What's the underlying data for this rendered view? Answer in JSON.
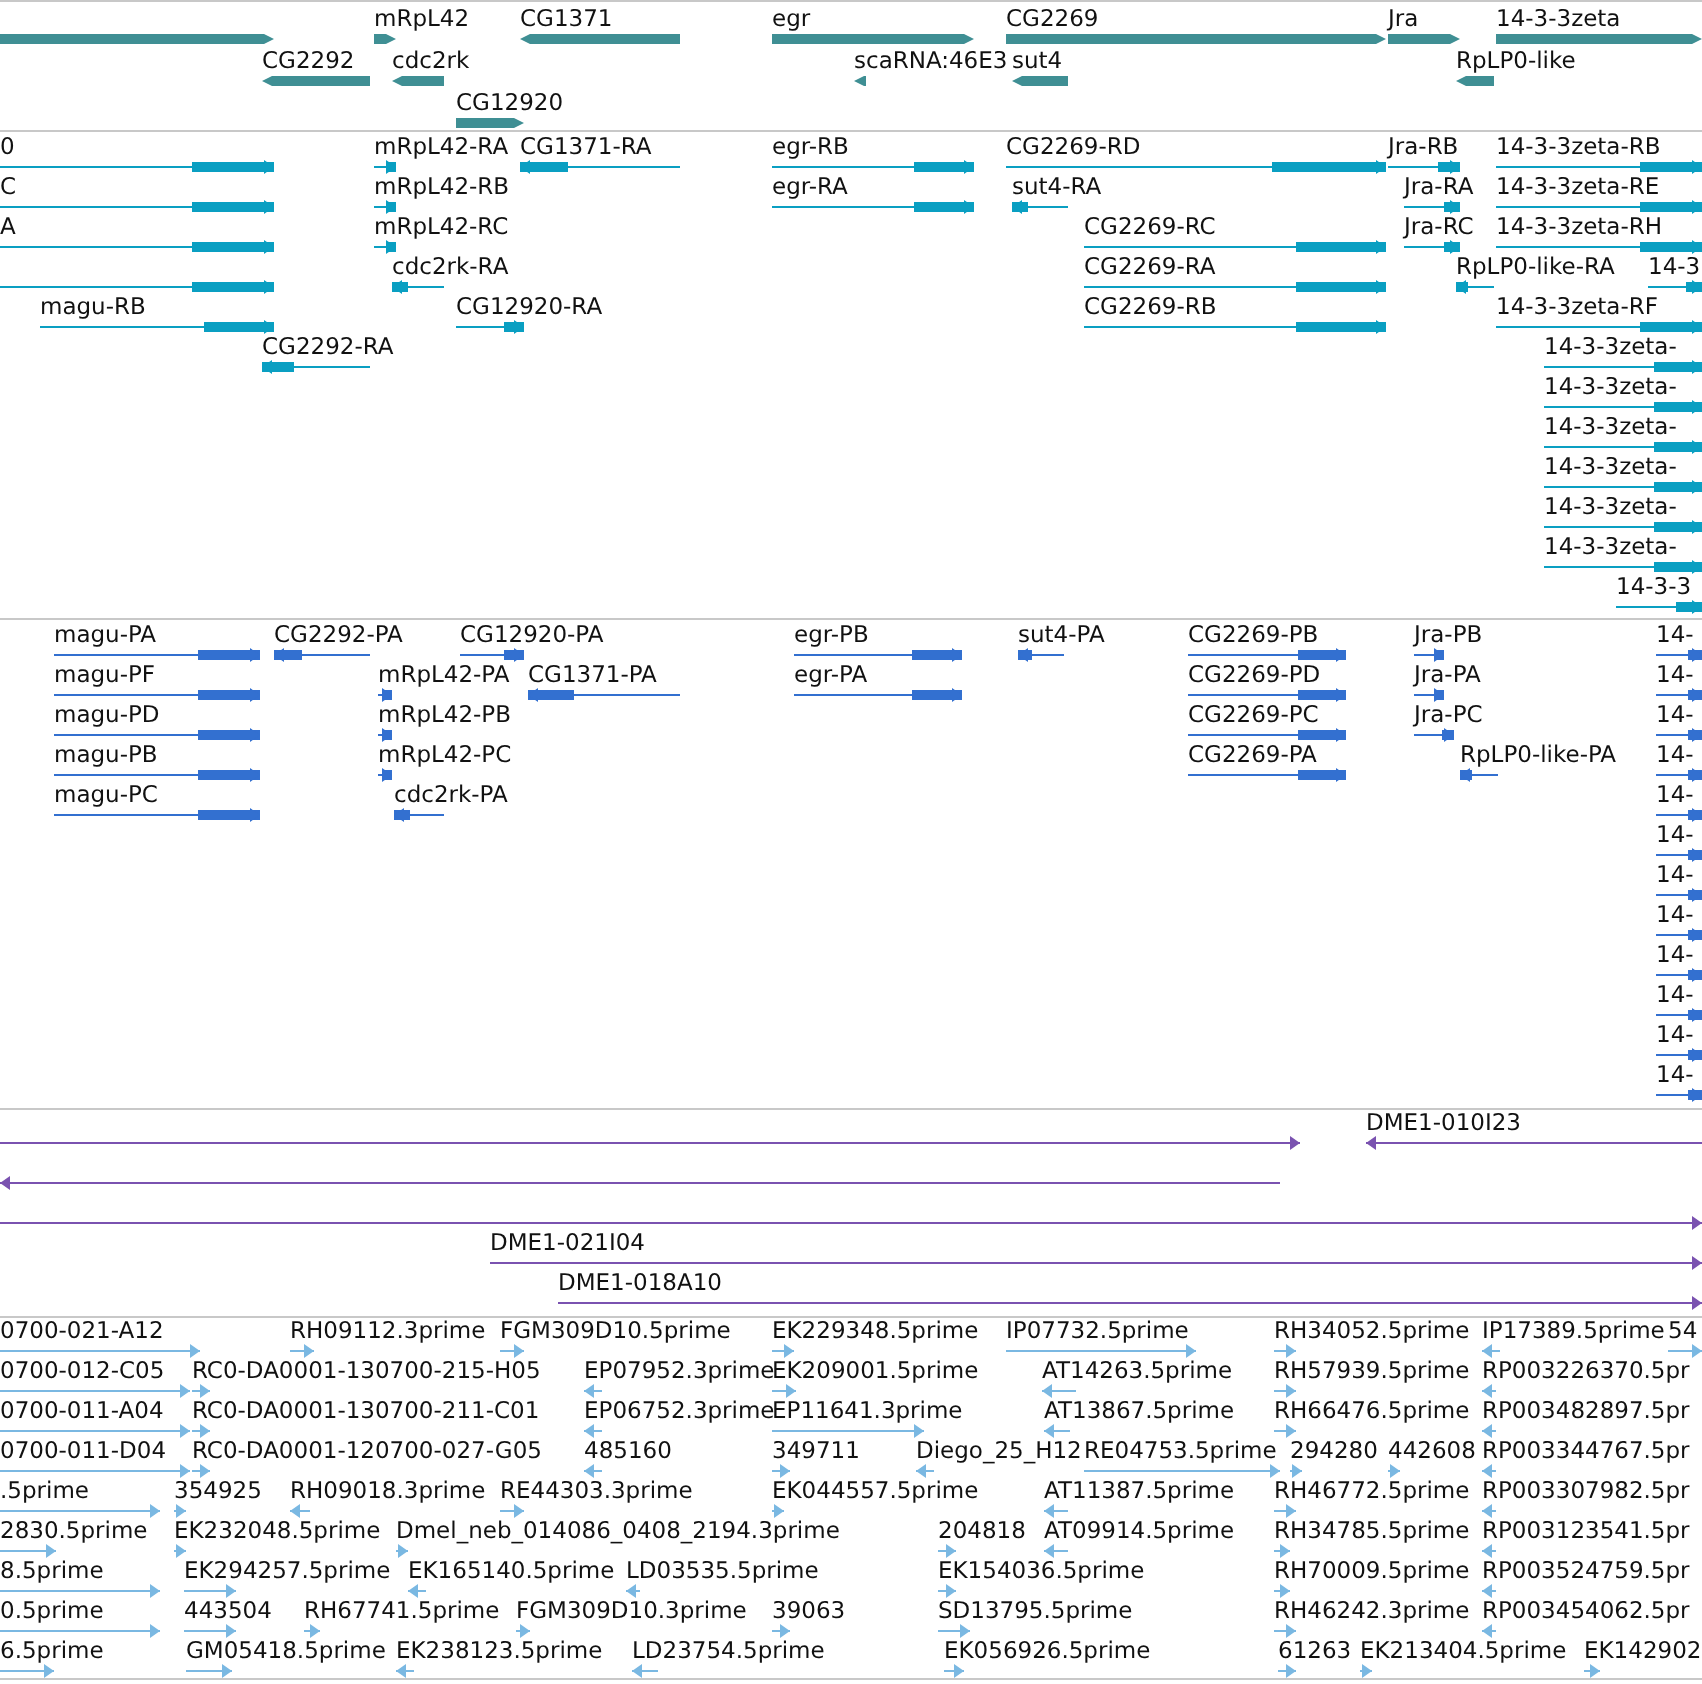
{
  "tracks": [
    {
      "kind": "gene",
      "features": [
        {
          "reverse": false
        },
        {
          "label": "mRpL42",
          "reverse": false
        },
        {
          "label": "CG1371",
          "reverse": true
        },
        {
          "label": "egr",
          "reverse": false
        },
        {
          "label": "CG2269",
          "reverse": false
        },
        {
          "label": "Jra",
          "reverse": false
        },
        {
          "label": "14-3-3zeta",
          "reverse": false
        },
        {
          "label": "CG2292",
          "reverse": true
        },
        {
          "label": "cdc2rk",
          "reverse": true
        },
        {
          "label": "scaRNA:46E3",
          "reverse": true
        },
        {
          "label": "sut4",
          "reverse": true
        },
        {
          "label": "RpLP0-like",
          "reverse": true
        },
        {
          "label": "CG12920",
          "reverse": false
        }
      ]
    },
    {
      "kind": "transcript",
      "features": [
        {
          "label": "0",
          "reverse": false
        },
        {
          "label": "mRpL42-RA",
          "reverse": false
        },
        {
          "label": "CG1371-RA",
          "reverse": true
        },
        {
          "label": "egr-RB",
          "reverse": false
        },
        {
          "label": "CG2269-RD",
          "reverse": false
        },
        {
          "label": "Jra-RB",
          "reverse": false
        },
        {
          "label": "14-3-3zeta-RB",
          "reverse": false
        },
        {
          "label": "C",
          "reverse": false
        },
        {
          "label": "mRpL42-RB",
          "reverse": false
        },
        {
          "label": "egr-RA",
          "reverse": false
        },
        {
          "label": "sut4-RA",
          "reverse": true
        },
        {
          "label": "Jra-RA",
          "reverse": false
        },
        {
          "label": "14-3-3zeta-RE",
          "reverse": false
        },
        {
          "label": "A",
          "reverse": false
        },
        {
          "label": "mRpL42-RC",
          "reverse": false
        },
        {
          "label": "CG2269-RC",
          "reverse": false
        },
        {
          "label": "Jra-RC",
          "reverse": false
        },
        {
          "label": "14-3-3zeta-RH",
          "reverse": false
        },
        {
          "reverse": false
        },
        {
          "label": "cdc2rk-RA",
          "reverse": true
        },
        {
          "label": "CG2269-RA",
          "reverse": false
        },
        {
          "label": "RpLP0-like-RA",
          "reverse": true
        },
        {
          "label": "14-3",
          "reverse": false
        },
        {
          "label": "magu-RB",
          "reverse": false
        },
        {
          "label": "CG12920-RA",
          "reverse": false
        },
        {
          "label": "CG2269-RB",
          "reverse": false
        },
        {
          "label": "14-3-3zeta-RF",
          "reverse": false
        },
        {
          "label": "CG2292-RA",
          "reverse": true
        },
        {
          "label": "14-3-3zeta-",
          "reverse": false
        },
        {
          "label": "14-3-3zeta-",
          "reverse": false
        },
        {
          "label": "14-3-3zeta-",
          "reverse": false
        },
        {
          "label": "14-3-3zeta-",
          "reverse": false
        },
        {
          "label": "14-3-3zeta-",
          "reverse": false
        },
        {
          "label": "14-3-3zeta-",
          "reverse": false
        },
        {
          "label": "14-3-3",
          "reverse": false
        }
      ]
    },
    {
      "kind": "protein",
      "features": [
        {
          "label": "magu-PA",
          "reverse": false
        },
        {
          "label": "CG2292-PA",
          "reverse": true
        },
        {
          "label": "CG12920-PA",
          "reverse": false
        },
        {
          "label": "egr-PB",
          "reverse": false
        },
        {
          "label": "sut4-PA",
          "reverse": true
        },
        {
          "label": "CG2269-PB",
          "reverse": false
        },
        {
          "label": "Jra-PB",
          "reverse": false
        },
        {
          "label": "14-",
          "reverse": false
        },
        {
          "label": "magu-PF",
          "reverse": false
        },
        {
          "label": "mRpL42-PA",
          "reverse": false
        },
        {
          "label": "CG1371-PA",
          "reverse": true
        },
        {
          "label": "egr-PA",
          "reverse": false
        },
        {
          "label": "CG2269-PD",
          "reverse": false
        },
        {
          "label": "Jra-PA",
          "reverse": false
        },
        {
          "label": "14-",
          "reverse": false
        },
        {
          "label": "magu-PD",
          "reverse": false
        },
        {
          "label": "mRpL42-PB",
          "reverse": false
        },
        {
          "label": "CG2269-PC",
          "reverse": false
        },
        {
          "label": "Jra-PC",
          "reverse": false
        },
        {
          "label": "14-",
          "reverse": false
        },
        {
          "label": "magu-PB",
          "reverse": false
        },
        {
          "label": "mRpL42-PC",
          "reverse": false
        },
        {
          "label": "CG2269-PA",
          "reverse": false
        },
        {
          "label": "RpLP0-like-PA",
          "reverse": true
        },
        {
          "label": "14-",
          "reverse": false
        },
        {
          "label": "magu-PC",
          "reverse": false
        },
        {
          "label": "cdc2rk-PA",
          "reverse": true
        },
        {
          "label": "14-",
          "reverse": false
        },
        {
          "label": "14-",
          "reverse": false
        },
        {
          "label": "14-",
          "reverse": false
        },
        {
          "label": "14-",
          "reverse": false
        },
        {
          "label": "14-",
          "reverse": false
        },
        {
          "label": "14-",
          "reverse": false
        },
        {
          "label": "14-",
          "reverse": false
        },
        {
          "label": "14-",
          "reverse": false
        }
      ]
    },
    {
      "kind": "clone",
      "features": [
        {
          "reverse": false
        },
        {
          "label": "DME1-010I23",
          "reverse": true
        },
        {
          "reverse": true
        },
        {
          "reverse": false
        },
        {
          "label": "DME1-021I04",
          "reverse": false
        },
        {
          "label": "DME1-018A10",
          "reverse": false
        }
      ]
    },
    {
      "kind": "est",
      "features": [
        {
          "label": "0700-021-A12",
          "reverse": false
        },
        {
          "label": "RH09112.3prime",
          "reverse": false
        },
        {
          "label": "FGM309D10.5prime",
          "reverse": false
        },
        {
          "label": "EK229348.5prime",
          "reverse": false
        },
        {
          "label": "IP07732.5prime",
          "reverse": false
        },
        {
          "label": "RH34052.5prime",
          "reverse": false
        },
        {
          "label": "IP17389.5prime",
          "reverse": true
        },
        {
          "label": "54",
          "reverse": false
        },
        {
          "label": "0700-012-C05",
          "reverse": false
        },
        {
          "label": "RC0-DA0001-130700-215-H05",
          "reverse": false
        },
        {
          "label": "EP07952.3prime",
          "reverse": true
        },
        {
          "label": "EK209001.5prime",
          "reverse": false
        },
        {
          "label": "AT14263.5prime",
          "reverse": true
        },
        {
          "label": "RH57939.5prime",
          "reverse": false
        },
        {
          "label": "RP003226370.5pr",
          "reverse": true
        },
        {
          "label": "0700-011-A04",
          "reverse": false
        },
        {
          "label": "RC0-DA0001-130700-211-C01",
          "reverse": false
        },
        {
          "label": "EP06752.3prime",
          "reverse": true
        },
        {
          "label": "EP11641.3prime",
          "reverse": false
        },
        {
          "label": "AT13867.5prime",
          "reverse": true
        },
        {
          "label": "RH66476.5prime",
          "reverse": false
        },
        {
          "label": "RP003482897.5pr",
          "reverse": true
        },
        {
          "label": "0700-011-D04",
          "reverse": false
        },
        {
          "label": "RC0-DA0001-120700-027-G05",
          "reverse": false
        },
        {
          "label": "485160",
          "reverse": true
        },
        {
          "label": "349711",
          "reverse": false
        },
        {
          "label": "Diego_25_H12",
          "reverse": true
        },
        {
          "label": "RE04753.5prime",
          "reverse": false
        },
        {
          "label": "294280",
          "reverse": false
        },
        {
          "label": "442608",
          "reverse": false
        },
        {
          "label": "RP003344767.5pr",
          "reverse": true
        },
        {
          "label": ".5prime",
          "reverse": false
        },
        {
          "label": "354925",
          "reverse": false
        },
        {
          "label": "RH09018.3prime",
          "reverse": true
        },
        {
          "label": "RE44303.3prime",
          "reverse": false
        },
        {
          "label": "EK044557.5prime",
          "reverse": false
        },
        {
          "label": "AT11387.5prime",
          "reverse": true
        },
        {
          "label": "RH46772.5prime",
          "reverse": false
        },
        {
          "label": "RP003307982.5pr",
          "reverse": true
        },
        {
          "label": "2830.5prime",
          "reverse": false
        },
        {
          "label": "EK232048.5prime",
          "reverse": false
        },
        {
          "label": "Dmel_neb_014086_0408_2194.3prime",
          "reverse": false
        },
        {
          "label": "204818",
          "reverse": false
        },
        {
          "label": "AT09914.5prime",
          "reverse": true
        },
        {
          "label": "RH34785.5prime",
          "reverse": false
        },
        {
          "label": "RP003123541.5pr",
          "reverse": true
        },
        {
          "label": "8.5prime",
          "reverse": false
        },
        {
          "label": "EK294257.5prime",
          "reverse": false
        },
        {
          "label": "EK165140.5prime",
          "reverse": true
        },
        {
          "label": "LD03535.5prime",
          "reverse": true
        },
        {
          "label": "EK154036.5prime",
          "reverse": false
        },
        {
          "label": "RH70009.5prime",
          "reverse": false
        },
        {
          "label": "RP003524759.5pr",
          "reverse": true
        },
        {
          "label": "0.5prime",
          "reverse": false
        },
        {
          "label": "443504",
          "reverse": false
        },
        {
          "label": "RH67741.5prime",
          "reverse": false
        },
        {
          "label": "FGM309D10.3prime",
          "reverse": false
        },
        {
          "label": "39063",
          "reverse": false
        },
        {
          "label": "SD13795.5prime",
          "reverse": false
        },
        {
          "label": "RH46242.3prime",
          "reverse": false
        },
        {
          "label": "RP003454062.5pr",
          "reverse": true
        },
        {
          "label": "6.5prime",
          "reverse": false
        },
        {
          "label": "GM05418.5prime",
          "reverse": false
        },
        {
          "label": "EK238123.5prime",
          "reverse": true
        },
        {
          "label": "LD23754.5prime",
          "reverse": true
        },
        {
          "label": "EK056926.5prime",
          "reverse": false
        },
        {
          "label": "61263",
          "reverse": false
        },
        {
          "label": "EK213404.5prime",
          "reverse": false
        },
        {
          "label": "EK142902",
          "reverse": false
        }
      ]
    }
  ]
}
